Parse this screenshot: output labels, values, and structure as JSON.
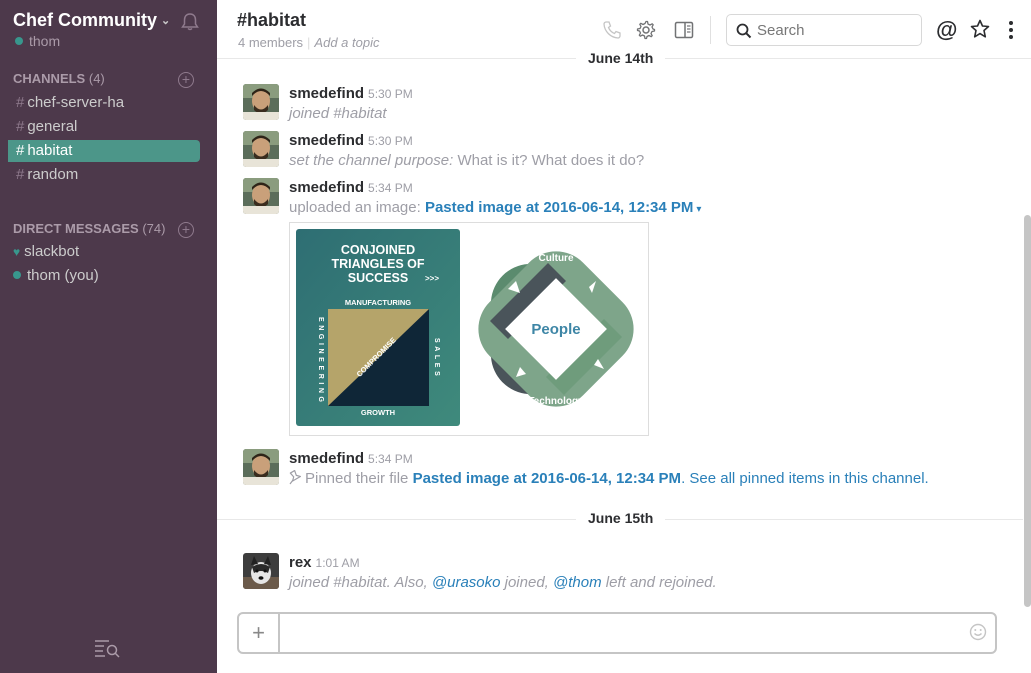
{
  "sidebar": {
    "team_name": "Chef Community",
    "team_chevron": "⌄",
    "user": "thom",
    "channels_heading": "CHANNELS",
    "channels_count": "(4)",
    "channels": [
      {
        "hash": "#",
        "name": "chef-server-ha"
      },
      {
        "hash": "#",
        "name": "general"
      },
      {
        "hash": "#",
        "name": "habitat",
        "active": true
      },
      {
        "hash": "#",
        "name": "random"
      }
    ],
    "dm_heading": "DIRECT MESSAGES",
    "dm_count": "(74)",
    "dms": [
      {
        "icon": "heart-icon",
        "glyph": "♥",
        "name": "slackbot"
      },
      {
        "icon": "presence-dot",
        "name": "thom (you)"
      }
    ],
    "add_glyph": "+"
  },
  "header": {
    "channel": "#habitat",
    "members": "4 members",
    "separator": "|",
    "add_topic": "Add a topic",
    "search_placeholder": "Search",
    "at_symbol": "@"
  },
  "days": {
    "first": "June 14th",
    "second": "June 15th"
  },
  "messages": [
    {
      "author": "smedefind",
      "time": "5:30 PM",
      "text": "joined #habitat"
    },
    {
      "author": "smedefind",
      "time": "5:30 PM",
      "italic": "set the channel purpose:",
      "text": " What is it? What does it do?"
    },
    {
      "author": "smedefind",
      "time": "5:34 PM",
      "prefix": "uploaded an image: ",
      "link": "Pasted image at 2016-06-14, 12:34 PM",
      "caret": "▾",
      "image": {
        "title_lines": [
          "CONJOINED",
          "TRIANGLES OF",
          "SUCCESS"
        ],
        "arrows": ">>>",
        "top_label": "MANUFACTURING",
        "left_label": "ENGINEERING",
        "right_label": "SALES",
        "bottom_label": "GROWTH",
        "diagonal_label": "COMPROMISE",
        "diamond_top": "Culture",
        "diamond_center": "People",
        "diamond_bottom": "Technology"
      }
    },
    {
      "author": "smedefind",
      "time": "5:34 PM",
      "prefix": "Pinned their file ",
      "link": "Pasted image at 2016-06-14, 12:34 PM",
      "suffix": ". See all pinned items in this channel."
    },
    {
      "author": "rex",
      "time": "1:01 AM",
      "text_a": "joined #habitat. Also, ",
      "mention_a": "@urasoko",
      "text_b": " joined, ",
      "mention_b": "@thom",
      "text_c": " left and rejoined."
    }
  ],
  "composer": {
    "plus": "+",
    "value": ""
  },
  "colors": {
    "sidebar_bg": "#4d394b",
    "active_channel": "#4c9689",
    "link": "#2a80b9",
    "presence": "#38978d"
  }
}
